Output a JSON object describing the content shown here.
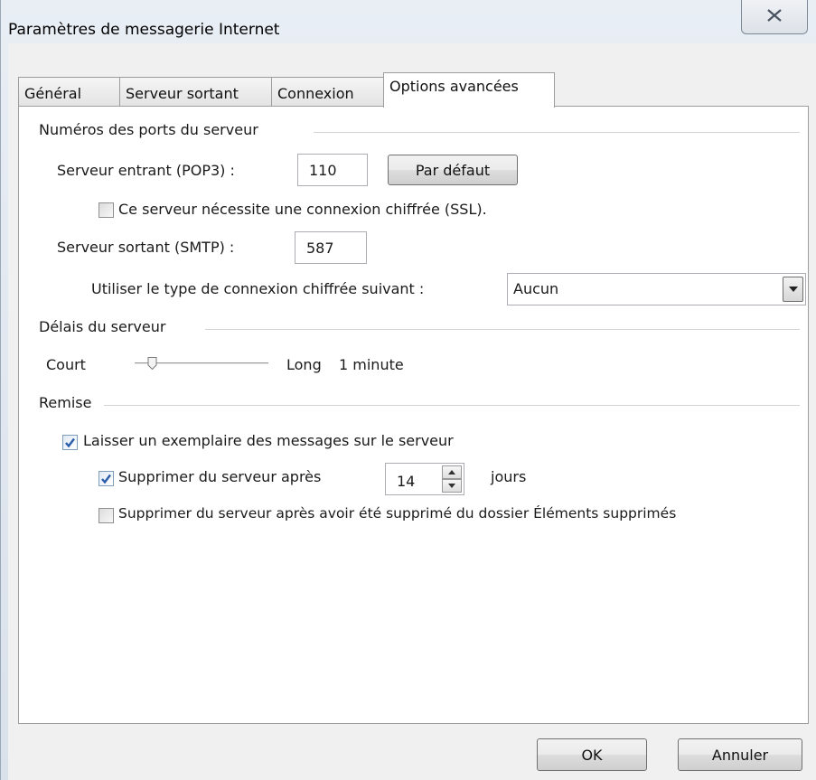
{
  "window": {
    "title": "Paramètres de messagerie Internet"
  },
  "tabs": [
    {
      "label": "Général",
      "active": false
    },
    {
      "label": "Serveur sortant",
      "active": false
    },
    {
      "label": "Connexion",
      "active": false
    },
    {
      "label": "Options avancées",
      "active": true
    }
  ],
  "ports": {
    "group_label": "Numéros des ports du serveur",
    "incoming_label": "Serveur entrant (POP3) :",
    "incoming_value": "110",
    "default_button": "Par défaut",
    "ssl_label": "Ce serveur nécessite une connexion chiffrée (SSL).",
    "ssl_checked": false,
    "outgoing_label": "Serveur sortant (SMTP) :",
    "outgoing_value": "587",
    "encryption_label": "Utiliser le type de connexion chiffrée suivant :",
    "encryption_value": "Aucun"
  },
  "timeouts": {
    "group_label": "Délais du serveur",
    "short_label": "Court",
    "long_label": "Long",
    "value_label": "1 minute",
    "slider_level": 0.1
  },
  "delivery": {
    "group_label": "Remise",
    "leave_copy_label": "Laisser un exemplaire des messages sur le serveur",
    "leave_copy_checked": true,
    "remove_after_label": "Supprimer du serveur après",
    "remove_after_checked": true,
    "remove_after_days": "14",
    "days_label": "jours",
    "remove_deleted_label": "Supprimer du serveur après avoir été supprimé du dossier Éléments supprimés",
    "remove_deleted_checked": false
  },
  "buttons": {
    "ok": "OK",
    "cancel": "Annuler"
  },
  "icons": {
    "close": "close-icon",
    "checkmark": "checkmark-icon",
    "dropdown": "chevron-down-icon",
    "spin_up": "spin-up-icon",
    "spin_down": "spin-down-icon",
    "slider_thumb": "slider-thumb-icon"
  },
  "colors": {
    "checkmark": "#2a5da8",
    "panel": "#ffffff",
    "dialog": "#f0f0f0"
  }
}
